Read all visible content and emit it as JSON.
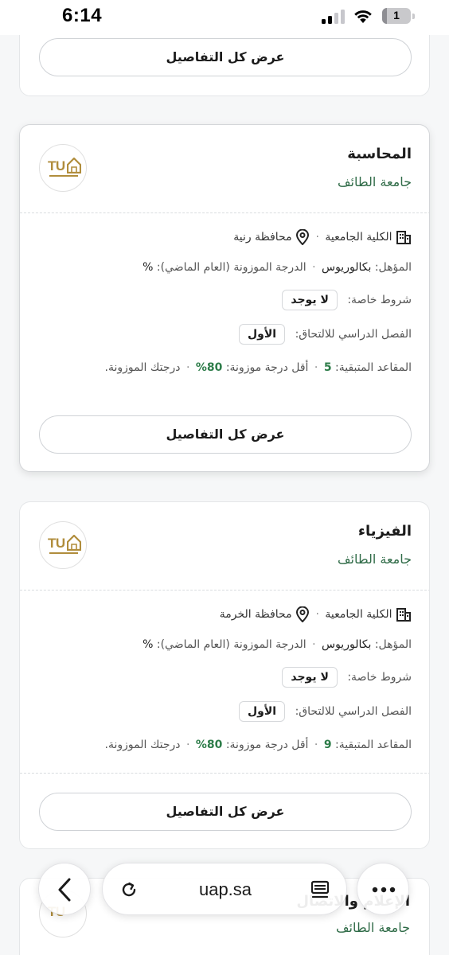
{
  "status_bar": {
    "time": "6:14",
    "battery_level": "1",
    "signal_bars_on": 2,
    "signal_bars_total": 4
  },
  "cards": [
    {
      "id": "top",
      "details_button": "عرض كل التفاصيل"
    },
    {
      "id": "accounting",
      "title": "المحاسبة",
      "university": "جامعة الطائف",
      "logo_text": "TU",
      "college": "الكلية الجامعية",
      "location": "محافظة رنية",
      "qualification_label": "المؤهل:",
      "qualification": "بكالوريوس",
      "weighted_label": "الدرجة الموزونة (العام الماضي):",
      "weighted_value": "%",
      "conditions_label": "شروط خاصة:",
      "conditions_value": "لا يوجد",
      "term_label": "الفصل الدراسي للالتحاق:",
      "term_value": "الأول",
      "seats_label": "المقاعد المتبقية:",
      "seats_value": "5",
      "min_label": "أقل درجة موزونة:",
      "min_value": "80%",
      "your_score": "درجتك الموزونة.",
      "details_button": "عرض كل التفاصيل"
    },
    {
      "id": "physics",
      "title": "الفيزياء",
      "university": "جامعة الطائف",
      "logo_text": "TU",
      "college": "الكلية الجامعية",
      "location": "محافظة الخرمة",
      "qualification_label": "المؤهل:",
      "qualification": "بكالوريوس",
      "weighted_label": "الدرجة الموزونة (العام الماضي):",
      "weighted_value": "%",
      "conditions_label": "شروط خاصة:",
      "conditions_value": "لا يوجد",
      "term_label": "الفصل الدراسي للالتحاق:",
      "term_value": "الأول",
      "seats_label": "المقاعد المتبقية:",
      "seats_value": "9",
      "min_label": "أقل درجة موزونة:",
      "min_value": "80%",
      "your_score": "درجتك الموزونة.",
      "details_button": "عرض كل التفاصيل"
    },
    {
      "id": "partial",
      "title": "الإعلام والاتصال",
      "university": "جامعة الطائف",
      "logo_text": "TU"
    }
  ],
  "browser": {
    "url": "uap.sa"
  },
  "colors": {
    "green": "#2e7d4a",
    "university_green": "#2f6b47",
    "logo_gold": "#b08d3c"
  }
}
